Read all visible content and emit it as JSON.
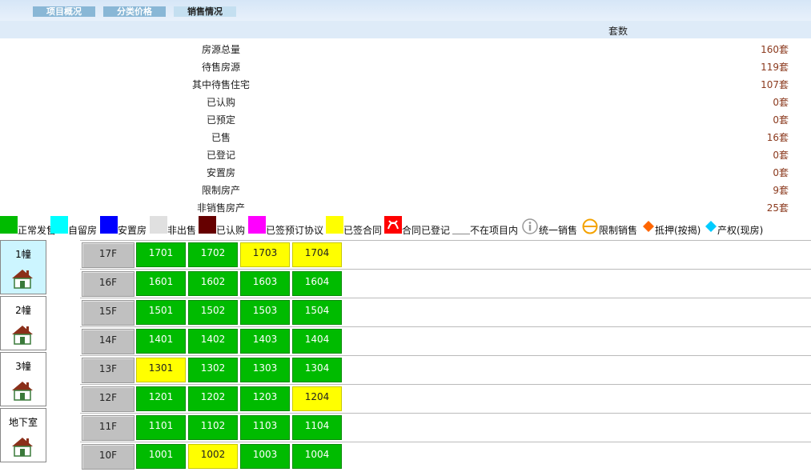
{
  "tabs": [
    "项目概况",
    "分类价格",
    "销售情况"
  ],
  "header": {
    "count_label": "套数"
  },
  "stats": [
    {
      "label": "房源总量",
      "value": "160套"
    },
    {
      "label": "待售房源",
      "value": "119套"
    },
    {
      "label": "其中待售住宅",
      "value": "107套"
    },
    {
      "label": "已认购",
      "value": "0套"
    },
    {
      "label": "已预定",
      "value": "0套"
    },
    {
      "label": "已售",
      "value": "16套"
    },
    {
      "label": "已登记",
      "value": "0套"
    },
    {
      "label": "安置房",
      "value": "0套"
    },
    {
      "label": "限制房产",
      "value": "9套"
    },
    {
      "label": "非销售房产",
      "value": "25套"
    }
  ],
  "legend": [
    {
      "label": "正常发售",
      "color": "#00bb00"
    },
    {
      "label": "自留房",
      "color": "#00ffff"
    },
    {
      "label": "安置房",
      "color": "#0000ff"
    },
    {
      "label": "非出售",
      "color": "#e0e0e0"
    },
    {
      "label": "已认购",
      "color": "#660000"
    },
    {
      "label": "已签预订协议",
      "color": "#ff00ff"
    },
    {
      "label": "已签合同",
      "color": "#ffff00"
    },
    {
      "label": "合同已登记",
      "color": "#ff0000"
    },
    {
      "label": "不在项目内",
      "color": "#ffffff"
    },
    {
      "label": "统一销售",
      "icon": "info-circle-icon"
    },
    {
      "label": "限制销售",
      "icon": "restricted-circle-icon"
    },
    {
      "label": "抵押(按揭)",
      "icon": "orange-diamond-icon",
      "color": "#ff6600"
    },
    {
      "label": "产权(现房)",
      "icon": "cyan-diamond-icon",
      "color": "#00ccff"
    }
  ],
  "buildings": [
    "1幢",
    "2幢",
    "3幢",
    "地下室"
  ],
  "floors": [
    {
      "floor": "17F",
      "units": [
        {
          "no": "1701",
          "status": "g"
        },
        {
          "no": "1702",
          "status": "g"
        },
        {
          "no": "1703",
          "status": "y"
        },
        {
          "no": "1704",
          "status": "y"
        }
      ]
    },
    {
      "floor": "16F",
      "units": [
        {
          "no": "1601",
          "status": "g"
        },
        {
          "no": "1602",
          "status": "g"
        },
        {
          "no": "1603",
          "status": "g"
        },
        {
          "no": "1604",
          "status": "g"
        }
      ]
    },
    {
      "floor": "15F",
      "units": [
        {
          "no": "1501",
          "status": "g"
        },
        {
          "no": "1502",
          "status": "g"
        },
        {
          "no": "1503",
          "status": "g"
        },
        {
          "no": "1504",
          "status": "g"
        }
      ]
    },
    {
      "floor": "14F",
      "units": [
        {
          "no": "1401",
          "status": "g"
        },
        {
          "no": "1402",
          "status": "g"
        },
        {
          "no": "1403",
          "status": "g"
        },
        {
          "no": "1404",
          "status": "g"
        }
      ]
    },
    {
      "floor": "13F",
      "units": [
        {
          "no": "1301",
          "status": "y"
        },
        {
          "no": "1302",
          "status": "g"
        },
        {
          "no": "1303",
          "status": "g"
        },
        {
          "no": "1304",
          "status": "g"
        }
      ]
    },
    {
      "floor": "12F",
      "units": [
        {
          "no": "1201",
          "status": "g"
        },
        {
          "no": "1202",
          "status": "g"
        },
        {
          "no": "1203",
          "status": "g"
        },
        {
          "no": "1204",
          "status": "y"
        }
      ]
    },
    {
      "floor": "11F",
      "units": [
        {
          "no": "1101",
          "status": "g"
        },
        {
          "no": "1102",
          "status": "g"
        },
        {
          "no": "1103",
          "status": "g"
        },
        {
          "no": "1104",
          "status": "g"
        }
      ]
    },
    {
      "floor": "10F",
      "units": [
        {
          "no": "1001",
          "status": "g"
        },
        {
          "no": "1002",
          "status": "y"
        },
        {
          "no": "1003",
          "status": "g"
        },
        {
          "no": "1004",
          "status": "g"
        }
      ]
    }
  ]
}
